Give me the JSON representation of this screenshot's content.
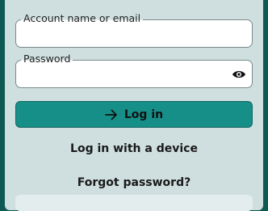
{
  "form": {
    "account_label": "Account name or email",
    "account_value": "",
    "password_label": "Password",
    "password_value": "",
    "show_password_icon": "eye-icon",
    "login_icon": "arrow-right-icon",
    "login_label": "Log in",
    "device_login_label": "Log in with a device",
    "forgot_password_label": "Forgot password?"
  },
  "colors": {
    "page_background": "#0f5953",
    "panel_background": "#cfdfdf",
    "primary_button": "#168f88",
    "text": "#1a1a1a"
  }
}
